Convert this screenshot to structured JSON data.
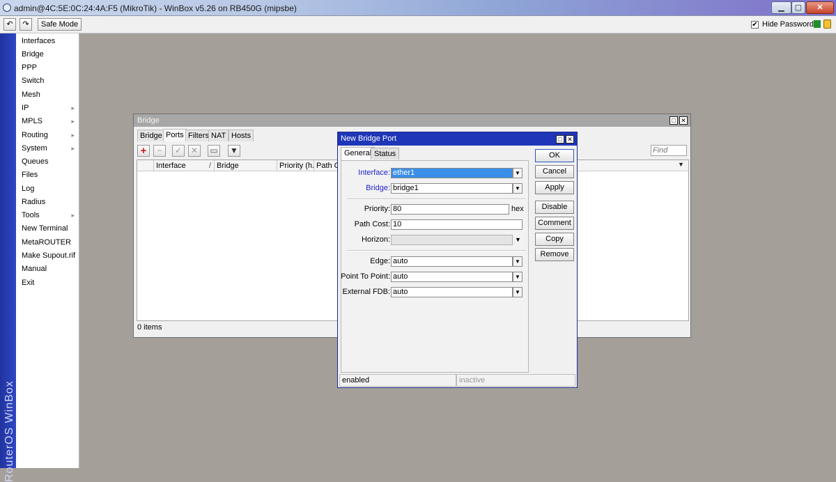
{
  "window": {
    "title": "admin@4C:5E:0C:24:4A:F5 (MikroTik) - WinBox v5.26 on RB450G (mipsbe)",
    "minimize": "▁",
    "maximize": "▢",
    "close": "✕"
  },
  "toolbar": {
    "undo": "↶",
    "redo": "↷",
    "safe_mode": "Safe Mode",
    "hide_passwords": "Hide Passwords",
    "hide_passwords_checked": "✔"
  },
  "side_banner": "RouterOS WinBox",
  "menu": [
    {
      "label": "Interfaces",
      "sub": ""
    },
    {
      "label": "Bridge",
      "sub": ""
    },
    {
      "label": "PPP",
      "sub": ""
    },
    {
      "label": "Switch",
      "sub": ""
    },
    {
      "label": "Mesh",
      "sub": ""
    },
    {
      "label": "IP",
      "sub": "▸"
    },
    {
      "label": "MPLS",
      "sub": "▸"
    },
    {
      "label": "Routing",
      "sub": "▸"
    },
    {
      "label": "System",
      "sub": "▸"
    },
    {
      "label": "Queues",
      "sub": ""
    },
    {
      "label": "Files",
      "sub": ""
    },
    {
      "label": "Log",
      "sub": ""
    },
    {
      "label": "Radius",
      "sub": ""
    },
    {
      "label": "Tools",
      "sub": "▸"
    },
    {
      "label": "New Terminal",
      "sub": ""
    },
    {
      "label": "MetaROUTER",
      "sub": ""
    },
    {
      "label": "Make Supout.rif",
      "sub": ""
    },
    {
      "label": "Manual",
      "sub": ""
    },
    {
      "label": "Exit",
      "sub": ""
    }
  ],
  "bridge_window": {
    "title": "Bridge",
    "tabs": [
      "Bridge",
      "Ports",
      "Filters",
      "NAT",
      "Hosts"
    ],
    "active_tab": "Ports",
    "find_placeholder": "Find",
    "columns": [
      "Interface",
      "Bridge",
      "Priority (h...",
      "Path Co"
    ],
    "sort_mark": "/",
    "status": "0 items",
    "icons": {
      "add": "+",
      "remove": "−",
      "enable": "✓",
      "disable": "✕",
      "comment": "▭",
      "filter": "▼"
    }
  },
  "dialog": {
    "title": "New Bridge Port",
    "tabs": [
      "General",
      "Status"
    ],
    "active_tab": "General",
    "fields": {
      "interface": {
        "label": "Interface:",
        "value": "ether1"
      },
      "bridge": {
        "label": "Bridge:",
        "value": "bridge1"
      },
      "priority": {
        "label": "Priority:",
        "value": "80",
        "suffix": "hex"
      },
      "path_cost": {
        "label": "Path Cost:",
        "value": "10"
      },
      "horizon": {
        "label": "Horizon:",
        "value": ""
      },
      "edge": {
        "label": "Edge:",
        "value": "auto"
      },
      "point_to_point": {
        "label": "Point To Point:",
        "value": "auto"
      },
      "external_fdb": {
        "label": "External FDB:",
        "value": "auto"
      }
    },
    "buttons": [
      "OK",
      "Cancel",
      "Apply",
      "Disable",
      "Comment",
      "Copy",
      "Remove"
    ],
    "status_left": "enabled",
    "status_right": "inactive"
  },
  "colors": {
    "desktop": "#a59f9a",
    "banner": "#2033a0",
    "dialog_title": "#2036b8",
    "selection": "#3b8fe8"
  }
}
